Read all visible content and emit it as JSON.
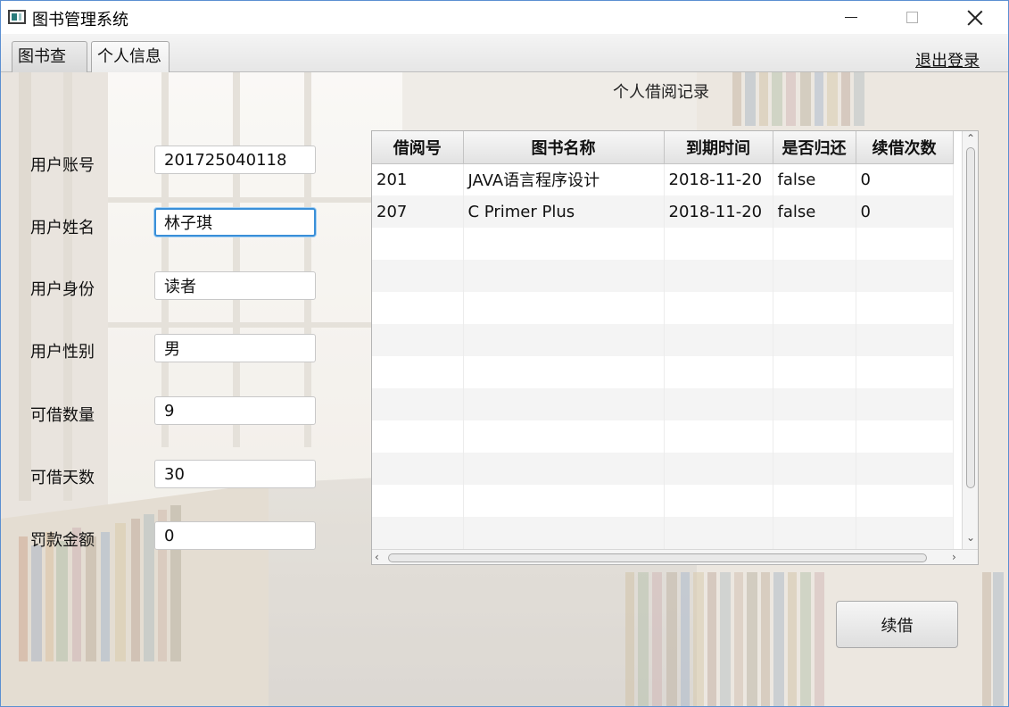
{
  "window": {
    "title": "图书管理系统"
  },
  "tabs": [
    {
      "label": "图书查询",
      "active": false
    },
    {
      "label": "个人信息",
      "active": true
    }
  ],
  "header": {
    "logout_label": "退出登录"
  },
  "section_title": "个人借阅记录",
  "form": {
    "fields": [
      {
        "label": "用户账号",
        "value": "201725040118"
      },
      {
        "label": "用户姓名",
        "value": "林子琪"
      },
      {
        "label": "用户身份",
        "value": "读者"
      },
      {
        "label": "用户性别",
        "value": "男"
      },
      {
        "label": "可借数量",
        "value": "9"
      },
      {
        "label": "可借天数",
        "value": "30"
      },
      {
        "label": "罚款金额",
        "value": "0"
      }
    ],
    "focused_field": "用户姓名"
  },
  "table": {
    "columns": [
      "借阅号",
      "图书名称",
      "到期时间",
      "是否归还",
      "续借次数"
    ],
    "rows": [
      [
        "201",
        "JAVA语言程序设计",
        "2018-11-20",
        "false",
        "0"
      ],
      [
        "207",
        "C Primer Plus",
        "2018-11-20",
        "false",
        "0"
      ]
    ],
    "empty_row_count": 10
  },
  "actions": {
    "renew_label": "续借"
  },
  "colors": {
    "focus_border": "#3a8fd8",
    "table_header_bg": "#e2e2e2",
    "window_border": "#5b8fd1"
  },
  "icons": [
    "app-icon",
    "minimize-icon",
    "maximize-icon",
    "close-icon",
    "scroll-up-icon",
    "scroll-down-icon",
    "scroll-left-icon",
    "scroll-right-icon"
  ]
}
